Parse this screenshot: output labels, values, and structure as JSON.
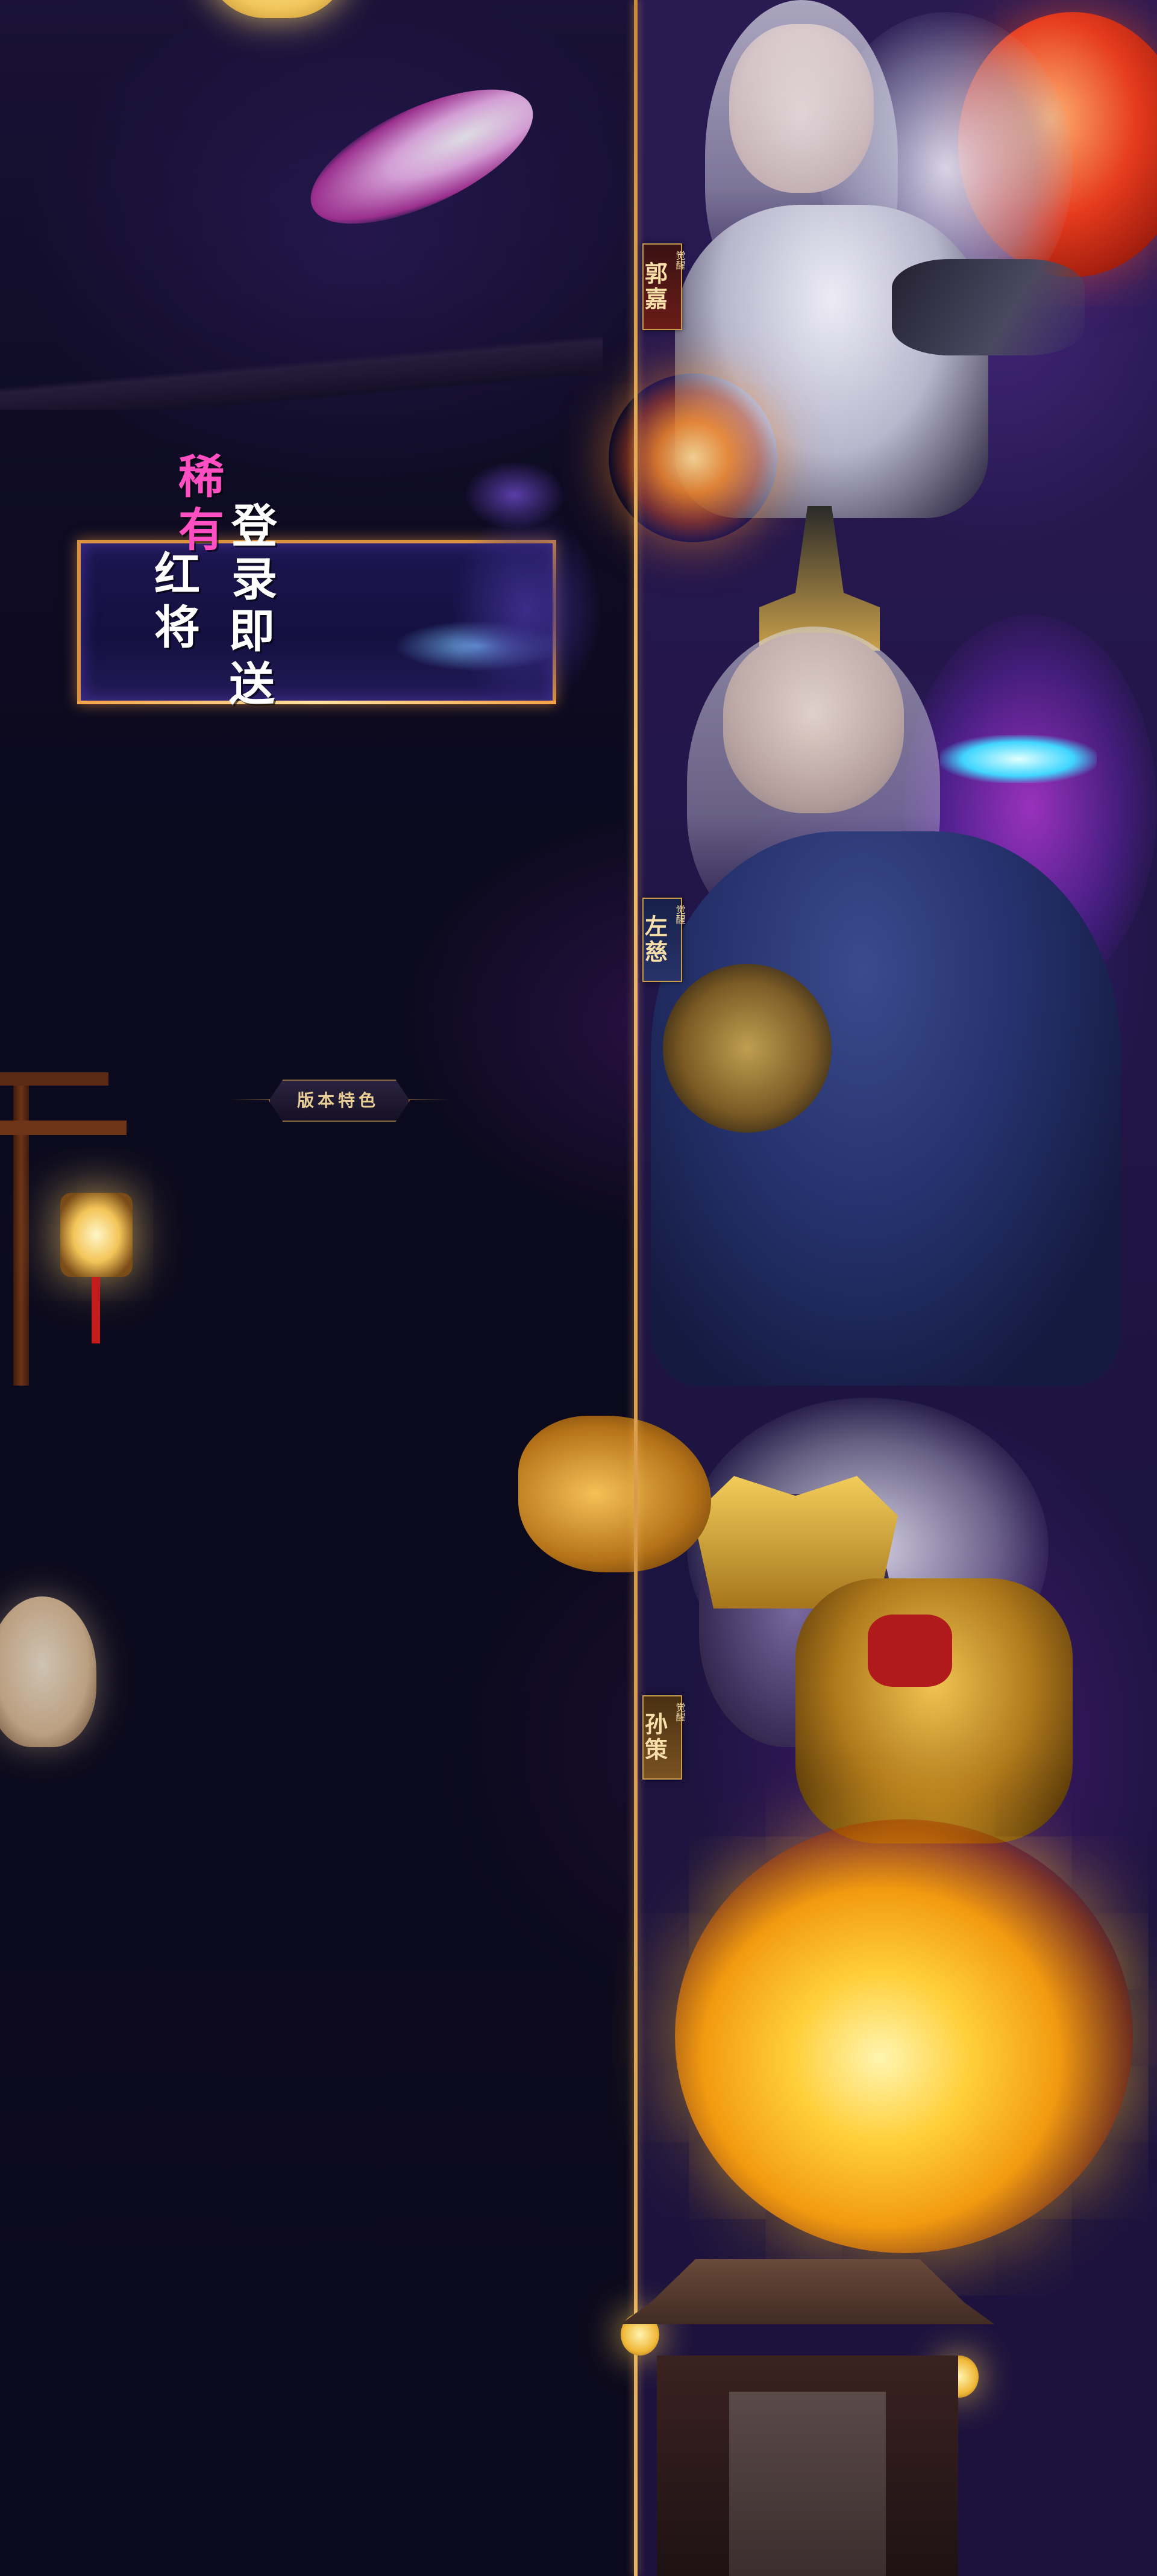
{
  "promo": {
    "col1": [
      "稀",
      "有"
    ],
    "col2": [
      "红",
      "将"
    ],
    "col3": [
      "登",
      "录"
    ],
    "col4": [
      "即",
      "送"
    ]
  },
  "section": {
    "title": "版本特色"
  },
  "heroes": [
    {
      "name": "郭嘉",
      "tag": "觉醒"
    },
    {
      "name": "左慈",
      "tag": "觉醒"
    },
    {
      "name": "孙策",
      "tag": "觉醒"
    }
  ],
  "colors": {
    "accent_gold": "#d8923e",
    "divider": "#f4c271",
    "background": "#0c0a1c",
    "promo_pink": "#ff3fb7"
  }
}
